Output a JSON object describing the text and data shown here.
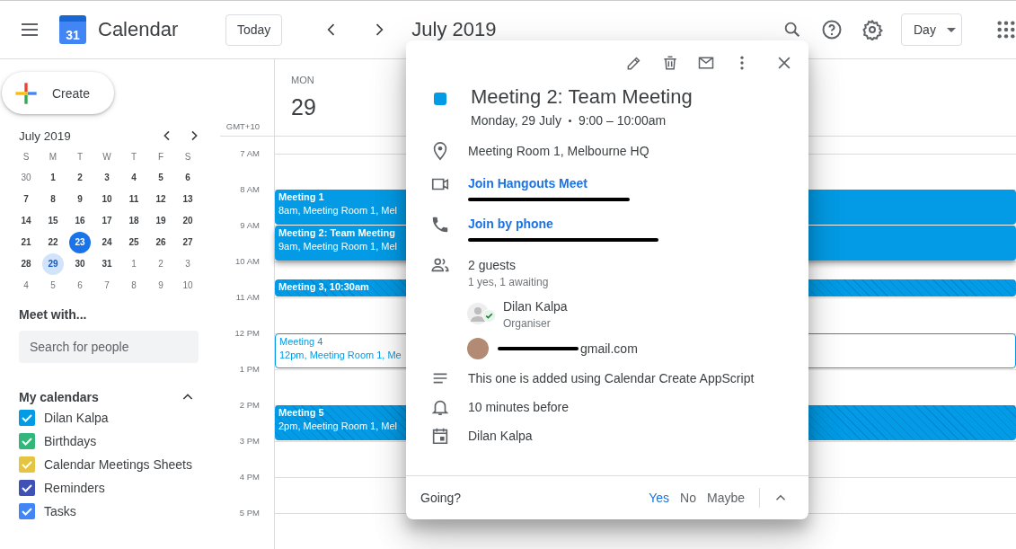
{
  "app": {
    "logo_day": "31",
    "title": "Calendar"
  },
  "toolbar": {
    "today": "Today",
    "period": "July 2019",
    "view": "Day"
  },
  "sidebar": {
    "create": "Create",
    "mini_calendar": {
      "month": "July 2019",
      "weekdays": [
        "S",
        "M",
        "T",
        "W",
        "T",
        "F",
        "S"
      ],
      "days": [
        {
          "label": "30",
          "muted": true,
          "today": false,
          "selected": false
        },
        {
          "label": "1",
          "muted": false,
          "today": false,
          "selected": false
        },
        {
          "label": "2",
          "muted": false,
          "today": false,
          "selected": false
        },
        {
          "label": "3",
          "muted": false,
          "today": false,
          "selected": false
        },
        {
          "label": "4",
          "muted": false,
          "today": false,
          "selected": false
        },
        {
          "label": "5",
          "muted": false,
          "today": false,
          "selected": false
        },
        {
          "label": "6",
          "muted": false,
          "today": false,
          "selected": false
        },
        {
          "label": "7",
          "muted": false,
          "today": false,
          "selected": false
        },
        {
          "label": "8",
          "muted": false,
          "today": false,
          "selected": false
        },
        {
          "label": "9",
          "muted": false,
          "today": false,
          "selected": false
        },
        {
          "label": "10",
          "muted": false,
          "today": false,
          "selected": false
        },
        {
          "label": "11",
          "muted": false,
          "today": false,
          "selected": false
        },
        {
          "label": "12",
          "muted": false,
          "today": false,
          "selected": false
        },
        {
          "label": "13",
          "muted": false,
          "today": false,
          "selected": false
        },
        {
          "label": "14",
          "muted": false,
          "today": false,
          "selected": false
        },
        {
          "label": "15",
          "muted": false,
          "today": false,
          "selected": false
        },
        {
          "label": "16",
          "muted": false,
          "today": false,
          "selected": false
        },
        {
          "label": "17",
          "muted": false,
          "today": false,
          "selected": false
        },
        {
          "label": "18",
          "muted": false,
          "today": false,
          "selected": false
        },
        {
          "label": "19",
          "muted": false,
          "today": false,
          "selected": false
        },
        {
          "label": "20",
          "muted": false,
          "today": false,
          "selected": false
        },
        {
          "label": "21",
          "muted": false,
          "today": false,
          "selected": false
        },
        {
          "label": "22",
          "muted": false,
          "today": false,
          "selected": false
        },
        {
          "label": "23",
          "muted": false,
          "today": true,
          "selected": false
        },
        {
          "label": "24",
          "muted": false,
          "today": false,
          "selected": false
        },
        {
          "label": "25",
          "muted": false,
          "today": false,
          "selected": false
        },
        {
          "label": "26",
          "muted": false,
          "today": false,
          "selected": false
        },
        {
          "label": "27",
          "muted": false,
          "today": false,
          "selected": false
        },
        {
          "label": "28",
          "muted": false,
          "today": false,
          "selected": false
        },
        {
          "label": "29",
          "muted": false,
          "today": false,
          "selected": true
        },
        {
          "label": "30",
          "muted": false,
          "today": false,
          "selected": false
        },
        {
          "label": "31",
          "muted": false,
          "today": false,
          "selected": false
        },
        {
          "label": "1",
          "muted": true,
          "today": false,
          "selected": false
        },
        {
          "label": "2",
          "muted": true,
          "today": false,
          "selected": false
        },
        {
          "label": "3",
          "muted": true,
          "today": false,
          "selected": false
        },
        {
          "label": "4",
          "muted": true,
          "today": false,
          "selected": false
        },
        {
          "label": "5",
          "muted": true,
          "today": false,
          "selected": false
        },
        {
          "label": "6",
          "muted": true,
          "today": false,
          "selected": false
        },
        {
          "label": "7",
          "muted": true,
          "today": false,
          "selected": false
        },
        {
          "label": "8",
          "muted": true,
          "today": false,
          "selected": false
        },
        {
          "label": "9",
          "muted": true,
          "today": false,
          "selected": false
        },
        {
          "label": "10",
          "muted": true,
          "today": false,
          "selected": false
        }
      ]
    },
    "meet_with": {
      "heading": "Meet with...",
      "placeholder": "Search for people"
    },
    "my_calendars": {
      "heading": "My calendars",
      "expanded": true,
      "items": [
        {
          "name": "Dilan Kalpa",
          "checked": true,
          "color": "#039be5"
        },
        {
          "name": "Birthdays",
          "checked": true,
          "color": "#33b679"
        },
        {
          "name": "Calendar Meetings Sheets",
          "checked": true,
          "color": "#e4c441"
        },
        {
          "name": "Reminders",
          "checked": true,
          "color": "#3f51b5"
        },
        {
          "name": "Tasks",
          "checked": true,
          "color": "#4285f4"
        }
      ]
    }
  },
  "day_view": {
    "weekday": "MON",
    "date": "29",
    "timezone": "GMT+10",
    "hours": [
      {
        "label": "7 AM"
      },
      {
        "label": "8 AM",
        "events": [
          {
            "title": "Meeting 1",
            "detail": "8am, Meeting Room 1, Mel",
            "kind": "solid",
            "selected": false
          }
        ]
      },
      {
        "label": "9 AM",
        "events": [
          {
            "title": "Meeting 2: Team Meeting",
            "detail": "9am, Meeting Room 1, Mel",
            "kind": "solid",
            "selected": true
          }
        ]
      },
      {
        "label": "10 AM",
        "events": [
          {
            "title": "Meeting 3, 10:30am",
            "kind": "hatched-short",
            "selected": false
          }
        ]
      },
      {
        "label": "11 AM"
      },
      {
        "label": "12 PM",
        "events": [
          {
            "title": "Meeting 4",
            "detail": "12pm, Meeting Room 1, Me",
            "kind": "outlined",
            "selected": false
          }
        ]
      },
      {
        "label": "1 PM"
      },
      {
        "label": "2 PM",
        "events": [
          {
            "title": "Meeting 5",
            "detail": "2pm, Meeting Room 1, Mel",
            "kind": "hatched",
            "selected": false
          }
        ]
      },
      {
        "label": "3 PM"
      },
      {
        "label": "4 PM"
      },
      {
        "label": "5 PM"
      }
    ]
  },
  "event_popup": {
    "title": "Meeting 2: Team Meeting",
    "color": "#039be5",
    "date": "Monday, 29 July",
    "time": "9:00 – 10:00am",
    "location": "Meeting Room 1, Melbourne HQ",
    "video_link": "Join Hangouts Meet",
    "phone_link": "Join by phone",
    "guests_title": "2 guests",
    "guests_summary": "1 yes, 1 awaiting",
    "guests": [
      {
        "name": "Dilan Kalpa",
        "role": "Organiser",
        "accepted": true,
        "kind": "silhouette"
      },
      {
        "name": "gmail.com",
        "kind": "photo",
        "accepted": false
      }
    ],
    "description": "This one is added using Calendar Create AppScript",
    "reminder": "10 minutes before",
    "calendar": "Dilan Kalpa",
    "rsvp": {
      "question": "Going?",
      "options": [
        {
          "label": "Yes",
          "selected": true
        },
        {
          "label": "No",
          "selected": false
        },
        {
          "label": "Maybe",
          "selected": false
        }
      ]
    }
  }
}
